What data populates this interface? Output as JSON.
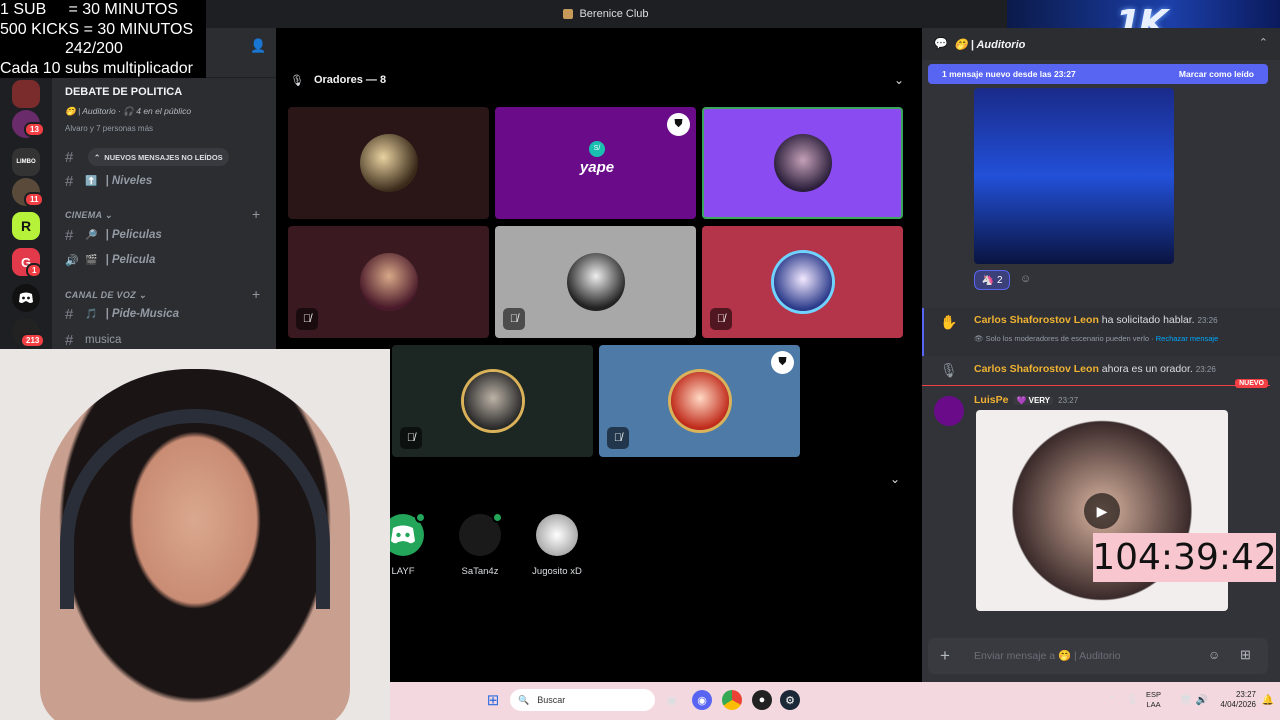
{
  "overlay": {
    "lines": [
      "1 SUB     = 30 MINUTOS",
      "500 KICKS = 30 MINUTOS",
      "242/200",
      "Cada 10 subs multiplicador"
    ]
  },
  "window": {
    "title": "Berenice Club"
  },
  "rail": {
    "badges": [
      "13",
      "11",
      "1",
      "213"
    ]
  },
  "channels": {
    "current_title": "DEBATE DE POLITICA",
    "current_sub": "🤭 | Auditorio · 🎧 4 en el público",
    "current_sub2": "Alvaro y 7 personas más",
    "unread_pill": "NUEVOS MENSAJES NO LEÍDOS",
    "niveles": "Niveles",
    "cat_cinema": "CINEMA",
    "peliculas": "Peliculas",
    "pelicula": "Pelicula",
    "cat_voz": "CANAL DE VOZ",
    "pide_musica": "Pide-Musica",
    "musica": "musica"
  },
  "stage": {
    "speakers_label": "Oradores — 8",
    "yape_label": "yape",
    "audience": [
      {
        "name": "LAYF",
        "color": "#23a55a"
      },
      {
        "name": "SaTan4z",
        "color": "#1a1a1a"
      },
      {
        "name": "Jugosito xD",
        "color": "#d0d0d0"
      }
    ]
  },
  "chat": {
    "channel": "🤭 | Auditorio",
    "new_bar": "1 mensaje nuevo desde las 23:27",
    "mark_read": "Marcar como leído",
    "reaction_count": "2",
    "msg1_name": "Carlos Shaforostov Leon",
    "msg1_text": "ha solicitado hablar.",
    "msg1_time": "23:26",
    "msg1_note": "Solo los moderadores de escenario pueden verlo · ",
    "msg1_reject": "Rechazar mensaje",
    "msg2_name": "Carlos Shaforostov Leon",
    "msg2_text": "ahora es un orador.",
    "msg2_time": "23:26",
    "new_tag": "NUEVO",
    "msg3_name": "LuisPe",
    "msg3_tag": "VERY",
    "msg3_time": "23:27",
    "input_placeholder": "Enviar mensaje a 🤭 | Auditorio"
  },
  "timer": "104:39:42",
  "taskbar": {
    "search": "Buscar",
    "lang1": "ESP",
    "lang2": "LAA",
    "time": "23:27",
    "date": "4/04/2026"
  }
}
